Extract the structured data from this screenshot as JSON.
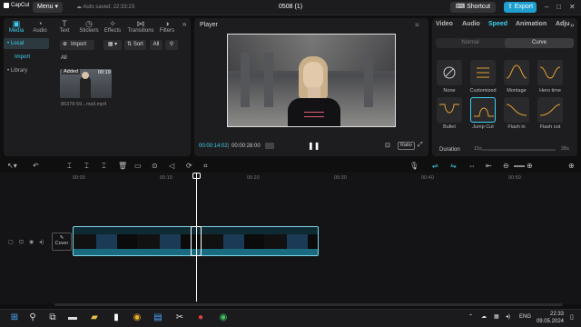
{
  "topbar": {
    "app_name": "CapCut",
    "menu_label": "Menu",
    "autosave": "Auto saved: 22:33:23",
    "doc_title": "0508 (1)",
    "shortcut_label": "Shortcut",
    "export_label": "Export"
  },
  "media_tabs": [
    "Media",
    "Audio",
    "Text",
    "Stickers",
    "Effects",
    "Transitions",
    "Filters"
  ],
  "media_sidebar": [
    "• Local",
    "Import",
    "• Library"
  ],
  "media": {
    "import_label": "Import",
    "sort_label": "Sort",
    "all_label": "All",
    "section_label": "All",
    "thumb_badge": "Added",
    "thumb_duration": "00:19",
    "thumb_name": "86378-59...mall.mp4"
  },
  "player": {
    "title": "Player",
    "time_current": "00:00:14:02",
    "time_total": "00:00:28:00",
    "ratio_label": "Ratio"
  },
  "props": {
    "tabs": [
      "Video",
      "Audio",
      "Speed",
      "Animation",
      "Adju"
    ],
    "active_tab": "Speed",
    "mode_normal": "Normal",
    "mode_curve": "Curve",
    "presets": [
      "None",
      "Customized",
      "Montage",
      "Hero time",
      "Bullet",
      "Jump Cut",
      "Flash in",
      "Flash out"
    ],
    "duration_label": "Duration",
    "duration_min": "15s",
    "duration_max": "28s"
  },
  "timeline": {
    "ruler": [
      "00:00",
      "00:10",
      "00:20",
      "00:30",
      "00:40",
      "00:50"
    ],
    "cover_label": "Cover"
  },
  "taskbar": {
    "lang": "ENG",
    "time": "22:33",
    "date": "09.05.2024"
  },
  "colors": {
    "accent": "#3dd1f0",
    "export": "#1e9fd0"
  }
}
